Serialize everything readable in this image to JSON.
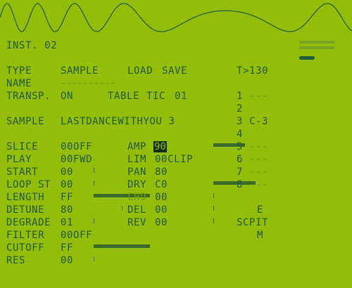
{
  "header": {
    "title": "INST. 02",
    "tempo": "T>130"
  },
  "labels": {
    "type": "TYPE",
    "name": "NAME",
    "transp": "TRANSP.",
    "sample": "SAMPLE",
    "slice": "SLICE",
    "play": "PLAY",
    "start": "START",
    "loop_st": "LOOP ST",
    "length": "LENGTH",
    "detune": "DETUNE",
    "degrade": "DEGRADE",
    "filter": "FILTER",
    "cutoff": "CUTOFF",
    "res": "RES",
    "amp": "AMP",
    "lim": "LIM",
    "pan": "PAN",
    "dry": "DRY",
    "cho": "CHO",
    "del": "DEL",
    "rev": "REV",
    "table": "TABLE",
    "tic": "TIC"
  },
  "values": {
    "type": "SAMPLE",
    "name_placeholder": "----------",
    "transp": "ON",
    "table_tic": "01",
    "sample": "LASTDANCEWITHYOU 3",
    "slice": "00OFF",
    "play": "00FWD",
    "start": "00",
    "loop_st": "00",
    "length": "FF",
    "detune": "80",
    "degrade": "01",
    "filter": "00OFF",
    "cutoff": "FF",
    "res": "00",
    "amp": "90",
    "lim": "00CLIP",
    "pan": "80",
    "dry": "C0",
    "cho": "00",
    "del": "00",
    "rev": "00"
  },
  "actions": {
    "load": "LOAD",
    "save": "SAVE"
  },
  "side_panel": {
    "rows": [
      {
        "num": "1",
        "note": "---"
      },
      {
        "num": "2",
        "note": ""
      },
      {
        "num": "3",
        "note": "C-3"
      },
      {
        "num": "4",
        "note": ""
      },
      {
        "num": "5",
        "note": "---"
      },
      {
        "num": "6",
        "note": "---"
      },
      {
        "num": "7",
        "note": "---"
      },
      {
        "num": "8",
        "note": "---"
      }
    ],
    "nav_e": "E",
    "nav_scpit": "SCPIT",
    "nav_m": "M"
  },
  "colors": {
    "background": "#94bd0a",
    "foreground": "#1f5a3a",
    "dim": "#6b9a12",
    "highlight": "#0f2e1c"
  }
}
